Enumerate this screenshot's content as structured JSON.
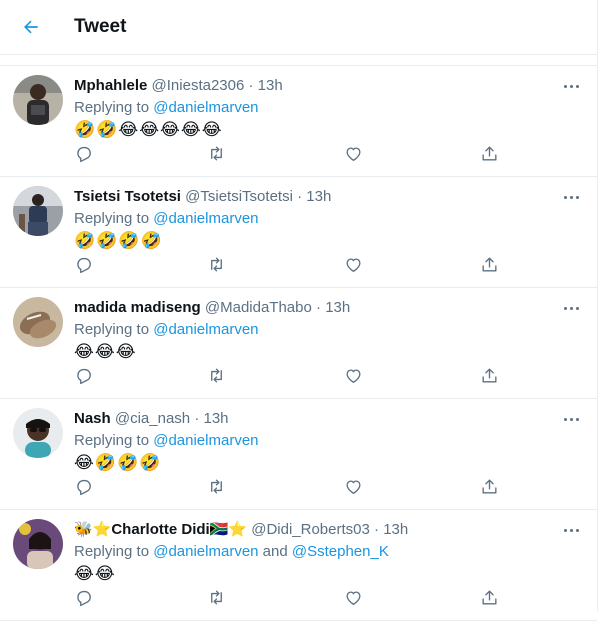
{
  "header": {
    "title": "Tweet"
  },
  "tweets": [
    {
      "name": "Mphahlele",
      "handle": "@Iniesta2306",
      "time": "13h",
      "replying_prefix": "Replying to ",
      "replying_to": "@danielmarven",
      "replying_joiner": "",
      "replying_to_2": "",
      "text": "🤣🤣😂😂😂😂😂"
    },
    {
      "name": "Tsietsi Tsotetsi",
      "handle": "@TsietsiTsotetsi",
      "time": "13h",
      "replying_prefix": "Replying to ",
      "replying_to": "@danielmarven",
      "replying_joiner": "",
      "replying_to_2": "",
      "text": "🤣🤣🤣🤣"
    },
    {
      "name": "madida madiseng",
      "handle": "@MadidaThabo",
      "time": "13h",
      "replying_prefix": "Replying to ",
      "replying_to": "@danielmarven",
      "replying_joiner": "",
      "replying_to_2": "",
      "text": "😂😂😂"
    },
    {
      "name": "Nash",
      "handle": "@cia_nash",
      "time": "13h",
      "replying_prefix": "Replying to ",
      "replying_to": "@danielmarven",
      "replying_joiner": "",
      "replying_to_2": "",
      "text": "😂🤣🤣🤣"
    },
    {
      "name": "🐝⭐Charlotte Didi🇿🇦⭐",
      "handle": "@Didi_Roberts03",
      "time": "13h",
      "replying_prefix": "Replying to ",
      "replying_to": "@danielmarven",
      "replying_joiner": " and ",
      "replying_to_2": "@Sstephen_K",
      "text": "😂😂"
    }
  ],
  "colors": {
    "accent": "#1b95e0",
    "muted": "#5b7083",
    "border": "#e6ecf0"
  },
  "icons": {
    "back": "arrow-left-icon",
    "reply": "comment-icon",
    "retweet": "retweet-icon",
    "like": "heart-icon",
    "share": "share-icon",
    "more": "more-horizontal-icon"
  }
}
